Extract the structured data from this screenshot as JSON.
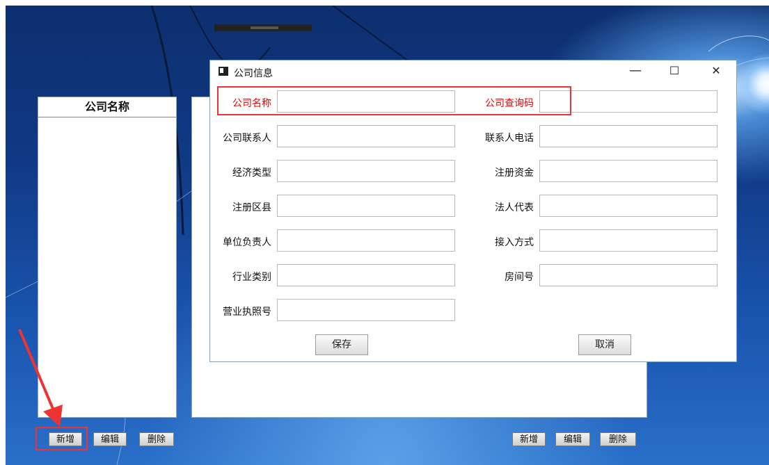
{
  "list_panel": {
    "header": "公司名称"
  },
  "left_toolbar": {
    "add": "新增",
    "edit": "编辑",
    "delete": "删除"
  },
  "right_toolbar": {
    "add": "新增",
    "edit": "编辑",
    "delete": "删除"
  },
  "dialog": {
    "title": "公司信息",
    "minimize": "—",
    "maximize": "☐",
    "close": "✕",
    "fields": [
      {
        "label": "公司名称",
        "value": ""
      },
      {
        "label": "公司查询码",
        "value": ""
      },
      {
        "label": "公司联系人",
        "value": ""
      },
      {
        "label": "联系人电话",
        "value": ""
      },
      {
        "label": "经济类型",
        "value": ""
      },
      {
        "label": "注册资金",
        "value": ""
      },
      {
        "label": "注册区县",
        "value": ""
      },
      {
        "label": "法人代表",
        "value": ""
      },
      {
        "label": "单位负责人",
        "value": ""
      },
      {
        "label": "接入方式",
        "value": ""
      },
      {
        "label": "行业类别",
        "value": ""
      },
      {
        "label": "房间号",
        "value": ""
      },
      {
        "label": "营业执照号",
        "value": ""
      }
    ],
    "save": "保存",
    "cancel": "取消"
  },
  "colors": {
    "highlight": "#e33333",
    "desktop": "#103a86"
  }
}
